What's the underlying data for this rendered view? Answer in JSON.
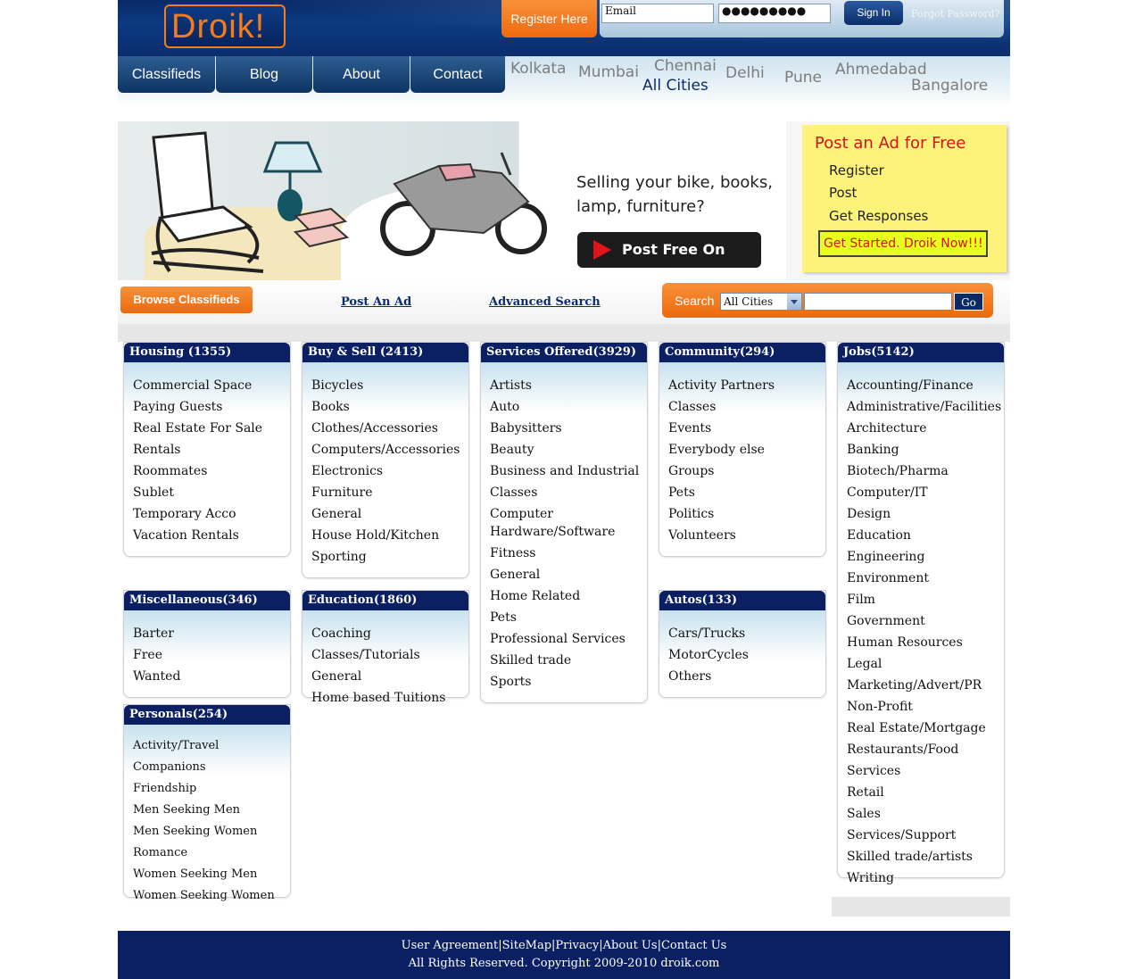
{
  "header": {
    "logo_text": "Droik!",
    "register_label": "Register Here",
    "email_value": "Email",
    "password_mask": "●●●●●●●●●",
    "signin_label": "Sign In",
    "forgot_label": "Forgot Password?"
  },
  "nav": {
    "tabs": [
      "Classifieds",
      "Blog",
      "About",
      "Contact"
    ],
    "cities": [
      "Kolkata",
      "Mumbai",
      "Chennai",
      "All Cities",
      "Delhi",
      "Pune",
      "Ahmedabad",
      "Bangalore"
    ]
  },
  "banner": {
    "selling_line1": "Selling your bike, books,",
    "selling_line2": "lamp, furniture?",
    "post_free_label": "Post Free On Droik",
    "sticky_title": "Post an Ad for Free",
    "sticky_steps": [
      "Register",
      "Post",
      "Get Responses"
    ],
    "sticky_cta": "Get Started. Droik Now!!!"
  },
  "actions": {
    "browse_label": "Browse Classifieds",
    "post_ad_label": "Post An Ad",
    "advanced_search_label": "Advanced Search",
    "search_label": "Search",
    "city_selected": "All Cities",
    "go_label": "Go"
  },
  "categories": {
    "housing": {
      "title": "Housing (1355)",
      "items": [
        "Commercial Space",
        "Paying Guests",
        "Real Estate For Sale",
        "Rentals",
        "Roommates",
        "Sublet",
        "Temporary Acco",
        "Vacation Rentals"
      ]
    },
    "buysell": {
      "title": "Buy & Sell (2413)",
      "items": [
        "Bicycles",
        "Books",
        "Clothes/Accessories",
        "Computers/Accessories",
        "Electronics",
        "Furniture",
        "General",
        "House Hold/Kitchen",
        "Sporting"
      ]
    },
    "services": {
      "title": "Services Offered(3929)",
      "items": [
        "Artists",
        "Auto",
        "Babysitters",
        "Beauty",
        "Business and Industrial",
        "Classes",
        "Computer Hardware/Software",
        "Fitness",
        "General",
        "Home Related",
        "Pets",
        "Professional Services",
        "Skilled trade",
        "Sports"
      ]
    },
    "community": {
      "title": "Community(294)",
      "items": [
        "Activity Partners",
        "Classes",
        "Events",
        "Everybody else",
        "Groups",
        "Pets",
        "Politics",
        "Volunteers"
      ]
    },
    "jobs": {
      "title": "Jobs(5142)",
      "items": [
        "Accounting/Finance",
        "Administrative/Facilities",
        "Architecture",
        "Banking",
        "Biotech/Pharma",
        "Computer/IT",
        "Design",
        "Education",
        "Engineering",
        "Environment",
        "Film",
        "Government",
        "Human Resources",
        "Legal",
        "Marketing/Advert/PR",
        "Non-Profit",
        "Real Estate/Mortgage",
        "Restaurants/Food Services",
        "Retail",
        "Sales",
        "Services/Support",
        "Skilled trade/artists",
        "Writing"
      ]
    },
    "misc": {
      "title": "Miscellaneous(346)",
      "items": [
        "Barter",
        "Free",
        "Wanted"
      ]
    },
    "education": {
      "title": "Education(1860)",
      "items": [
        "Coaching Classes/Tutorials",
        "General",
        "Home based Tuitions"
      ]
    },
    "autos": {
      "title": "Autos(133)",
      "items": [
        "Cars/Trucks",
        "MotorCycles",
        "Others"
      ]
    },
    "personals": {
      "title": "Personals(254)",
      "items": [
        "Activity/Travel Companions",
        "Friendship",
        "Men Seeking Men",
        "Men Seeking Women",
        "Romance",
        "Women Seeking Men",
        "Women Seeking Women"
      ]
    }
  },
  "footer": {
    "links": [
      "User Agreement",
      "SiteMap",
      "Privacy",
      "About Us",
      "Contact Us"
    ],
    "copyright": "All Rights Reserved. Copyright 2009-2010 droik.com"
  }
}
